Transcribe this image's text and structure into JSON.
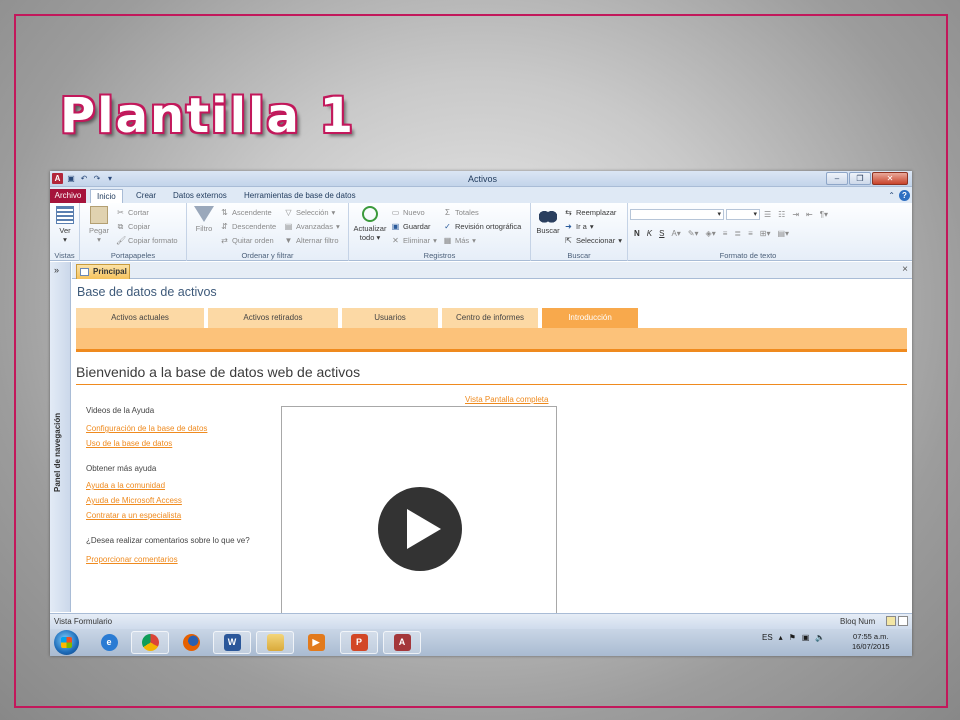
{
  "slide": {
    "title": "Plantilla 1",
    "frame_color": "#c2185b"
  },
  "window": {
    "title": "Activos",
    "app_icon_letter": "A"
  },
  "ribbon_tabs": [
    "Archivo",
    "Inicio",
    "Crear",
    "Datos externos",
    "Herramientas de base de datos"
  ],
  "ribbon": {
    "vistas": {
      "label": "Vistas",
      "ver": "Ver"
    },
    "portapapeles": {
      "label": "Portapapeles",
      "pegar": "Pegar",
      "cortar": "Cortar",
      "copiar": "Copiar",
      "copiar_formato": "Copiar formato"
    },
    "ordenar": {
      "label": "Ordenar y filtrar",
      "filtro": "Filtro",
      "ascendente": "Ascendente",
      "descendente": "Descendente",
      "quitar_orden": "Quitar orden",
      "seleccion": "Selección",
      "avanzadas": "Avanzadas",
      "alternar_filtro": "Alternar filtro"
    },
    "registros": {
      "label": "Registros",
      "actualizar": "Actualizar",
      "todo": "todo",
      "nuevo": "Nuevo",
      "guardar": "Guardar",
      "eliminar": "Eliminar",
      "totales": "Totales",
      "revision": "Revisión ortográfica",
      "mas": "Más"
    },
    "buscar": {
      "label": "Buscar",
      "buscar": "Buscar",
      "reemplazar": "Reemplazar",
      "ir_a": "Ir a",
      "seleccionar": "Seleccionar"
    },
    "formato": {
      "label": "Formato de texto"
    }
  },
  "nav_pane": {
    "label": "Panel de navegación",
    "toggle": "»"
  },
  "doc_tab": {
    "label": "Principal",
    "close": "×"
  },
  "form": {
    "db_title": "Base de datos de activos",
    "tabs": [
      "Activos actuales",
      "Activos retirados",
      "Usuarios",
      "Centro de informes",
      "Introducción"
    ],
    "active_tab": "Introducción",
    "welcome": "Bienvenido a la base de datos web de activos",
    "fullscreen_link": "Vista Pantalla completa",
    "videos_heading": "Videos de la Ayuda",
    "video_links": [
      "Configuración de la base de datos",
      "Uso de la base de datos"
    ],
    "more_help_heading": "Obtener más ayuda",
    "help_links": [
      "Ayuda a la comunidad",
      "Ayuda de Microsoft Access",
      "Contratar a un especialista"
    ],
    "feedback_question": "¿Desea realizar comentarios sobre lo que ve?",
    "feedback_link": "Proporcionar comentarios"
  },
  "status": {
    "left": "Vista Formulario",
    "right": "Bloq Num"
  },
  "taskbar": {
    "apps": [
      {
        "name": "internet-explorer-icon",
        "letter": "e",
        "color": "#2a7bd3"
      },
      {
        "name": "chrome-icon",
        "letter": "",
        "color": "#db4437"
      },
      {
        "name": "firefox-icon",
        "letter": "",
        "color": "#e66000"
      },
      {
        "name": "word-icon",
        "letter": "W",
        "color": "#2b579a"
      },
      {
        "name": "explorer-icon",
        "letter": "",
        "color": "#e8b84a"
      },
      {
        "name": "media-player-icon",
        "letter": "▶",
        "color": "#e27a1c"
      },
      {
        "name": "powerpoint-icon",
        "letter": "P",
        "color": "#d24726"
      },
      {
        "name": "access-icon",
        "letter": "A",
        "color": "#a4373a"
      }
    ],
    "language": "ES",
    "time": "07:55 a.m.",
    "date": "16/07/2015"
  },
  "colors": {
    "accent_orange": "#ef8a1e",
    "tab_orange": "#fcd9a5",
    "access_red": "#a5133b"
  }
}
